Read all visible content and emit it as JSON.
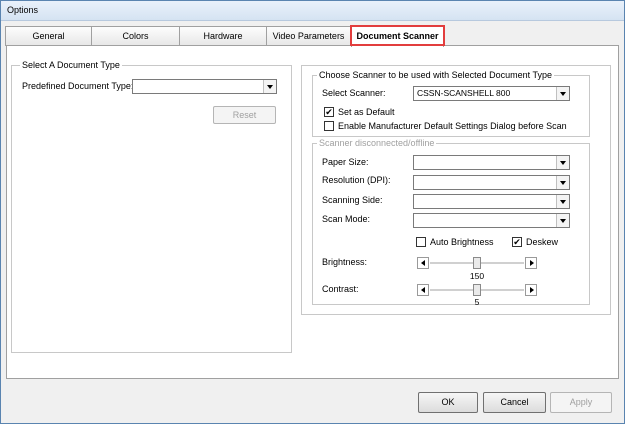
{
  "window": {
    "title": "Options"
  },
  "tabs": [
    {
      "label": "General"
    },
    {
      "label": "Colors"
    },
    {
      "label": "Hardware"
    },
    {
      "label": "Video Parameters"
    },
    {
      "label": "Document Scanner"
    }
  ],
  "select_doc_group": {
    "title": "Select A Document Type",
    "predefined_label": "Predefined Document Type:",
    "predefined_value": "",
    "reset_label": "Reset"
  },
  "scanner_group": {
    "title": "Choose Scanner to be used with Selected Document Type",
    "select_label": "Select Scanner:",
    "select_value": "CSSN-SCANSHELL 800",
    "set_default_label": "Set as Default",
    "set_default_checked": true,
    "mfr_dialog_label": "Enable Manufacturer Default Settings Dialog before Scan",
    "mfr_dialog_checked": false
  },
  "status_group": {
    "title": "Scanner disconnected/offline",
    "paper_size_label": "Paper Size:",
    "paper_size_value": "",
    "resolution_label": "Resolution (DPI):",
    "resolution_value": "",
    "scanning_side_label": "Scanning Side:",
    "scanning_side_value": "",
    "scan_mode_label": "Scan Mode:",
    "scan_mode_value": "",
    "auto_brightness_label": "Auto Brightness",
    "auto_brightness_checked": false,
    "deskew_label": "Deskew",
    "deskew_checked": true,
    "brightness_label": "Brightness:",
    "brightness_value": "150",
    "brightness_fraction": 0.5,
    "contrast_label": "Contrast:",
    "contrast_value": "5",
    "contrast_fraction": 0.5
  },
  "footer": {
    "ok_label": "OK",
    "cancel_label": "Cancel",
    "apply_label": "Apply"
  },
  "colors": {
    "highlight": "#e23d3d",
    "accent": "#5a84b0"
  }
}
